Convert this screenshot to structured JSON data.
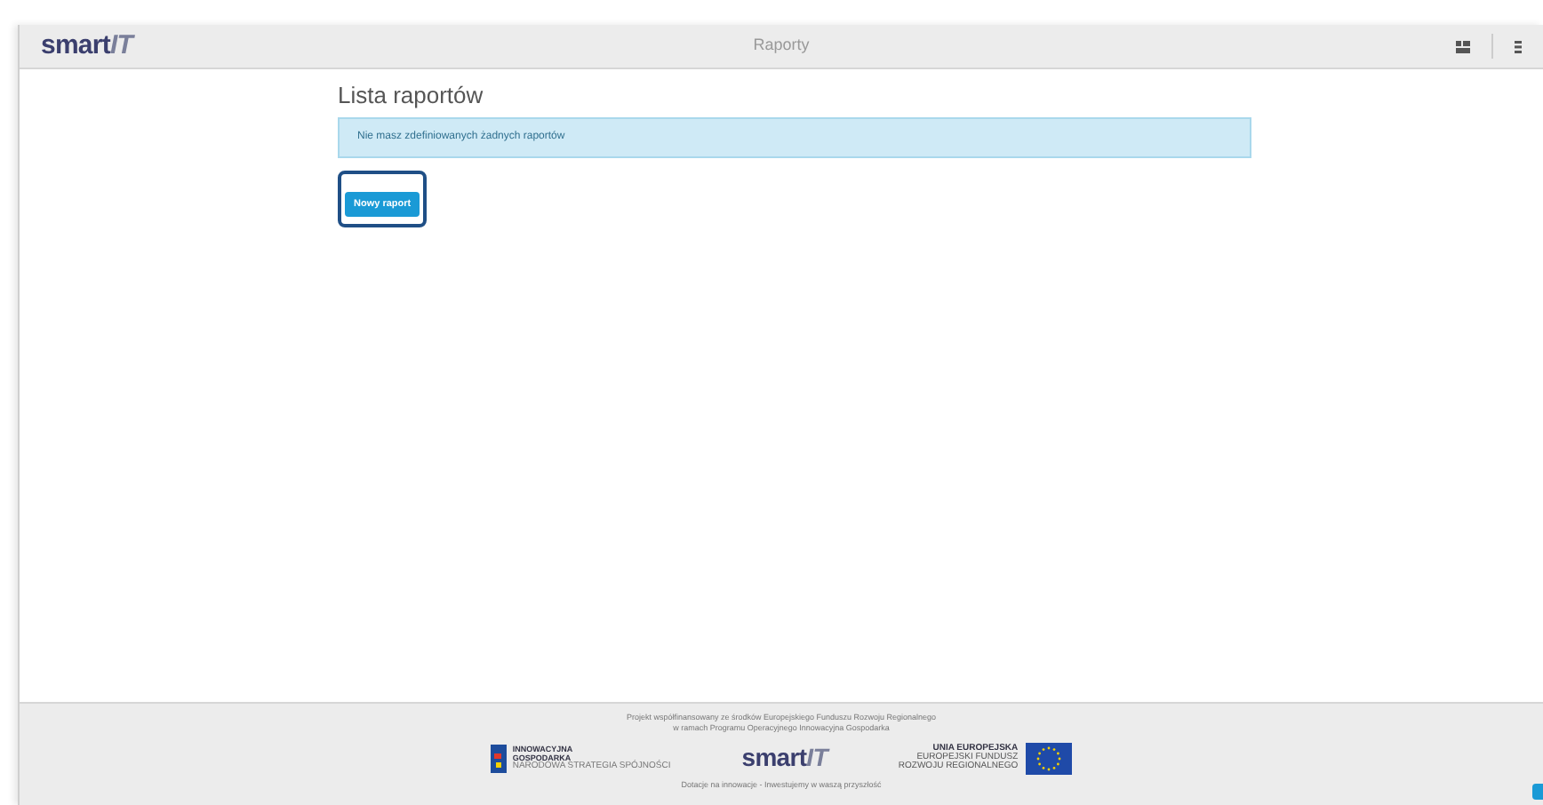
{
  "header": {
    "logo": {
      "main": "smart",
      "accent": "IT"
    },
    "title": "Raporty"
  },
  "page": {
    "heading": "Lista raportów",
    "alert": "Nie masz zdefiniowanych żadnych raportów",
    "button": "Nowy raport"
  },
  "footer": {
    "lines": [
      "Projekt współfinansowany ze środków Europejskiego Funduszu Rozwoju Regionalnego",
      "w ramach Programu Operacyjnego Innowacyjna Gospodarka"
    ],
    "ig_logo": {
      "title": [
        "INNOWACYJNA",
        "GOSPODARKA"
      ],
      "subtitle": "NARODOWA STRATEGIA SPÓJNOŚCI"
    },
    "logo": {
      "main": "smart",
      "accent": "IT"
    },
    "eu_logo": {
      "title": "UNIA EUROPEJSKA",
      "subtitle": [
        "EUROPEJSKI FUNDUSZ",
        "ROZWOJU REGIONALNEGO"
      ]
    },
    "tagline": "Dotacje na innowacje - Inwestujemy w waszą przyszłość"
  }
}
